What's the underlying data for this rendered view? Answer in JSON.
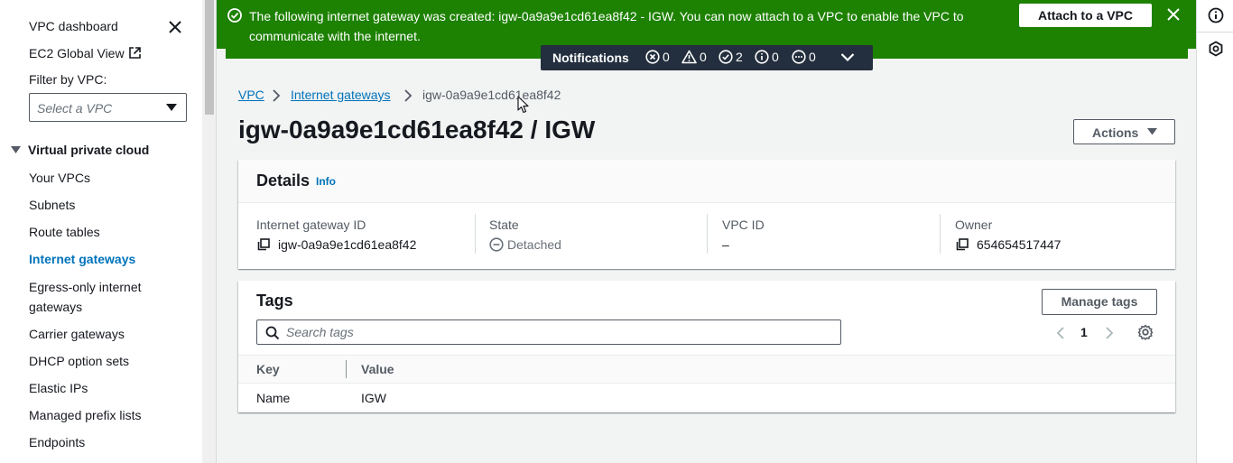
{
  "sidebar": {
    "dashboard": "VPC dashboard",
    "global_view": "EC2 Global View",
    "filter_label": "Filter by VPC:",
    "filter_placeholder": "Select a VPC",
    "section": "Virtual private cloud",
    "items": [
      {
        "label": "Your VPCs"
      },
      {
        "label": "Subnets"
      },
      {
        "label": "Route tables"
      },
      {
        "label": "Internet gateways",
        "active": true
      },
      {
        "label": "Egress-only internet gateways"
      },
      {
        "label": "Carrier gateways"
      },
      {
        "label": "DHCP option sets"
      },
      {
        "label": "Elastic IPs"
      },
      {
        "label": "Managed prefix lists"
      },
      {
        "label": "Endpoints"
      }
    ]
  },
  "flash": {
    "message": "The following internet gateway was created: igw-0a9a9e1cd61ea8f42 - IGW. You can now attach to a VPC to enable the VPC to communicate with the internet.",
    "action": "Attach to a VPC",
    "color": "#1d8102"
  },
  "notifications": {
    "title": "Notifications",
    "errors": "0",
    "warnings": "0",
    "success": "2",
    "info": "0",
    "in_progress": "0"
  },
  "breadcrumb": [
    "VPC",
    "Internet gateways",
    "igw-0a9a9e1cd61ea8f42"
  ],
  "page": {
    "title": "igw-0a9a9e1cd61ea8f42 / IGW",
    "actions": "Actions"
  },
  "details": {
    "heading": "Details",
    "info": "Info",
    "fields": [
      {
        "label": "Internet gateway ID",
        "value": "igw-0a9a9e1cd61ea8f42"
      },
      {
        "label": "State",
        "value": "Detached"
      },
      {
        "label": "VPC ID",
        "value": "–"
      },
      {
        "label": "Owner",
        "value": "654654517447"
      }
    ]
  },
  "tags": {
    "heading": "Tags",
    "manage": "Manage tags",
    "search_placeholder": "Search tags",
    "page": "1",
    "columns": [
      "Key",
      "Value"
    ],
    "rows": [
      {
        "key": "Name",
        "value": "IGW"
      }
    ]
  }
}
